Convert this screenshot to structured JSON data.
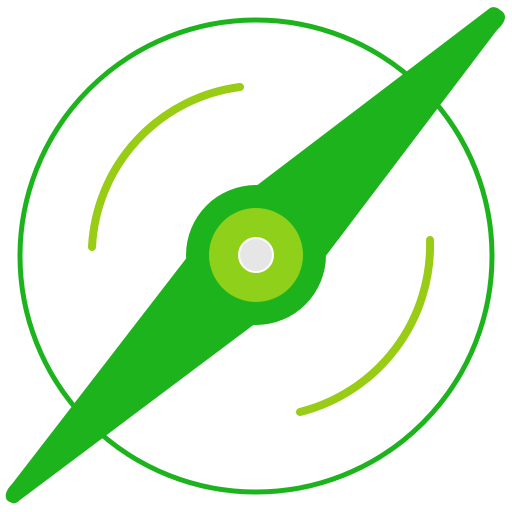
{
  "icon": {
    "name": "propeller-icon",
    "colors": {
      "ring": "#1db31d",
      "blade": "#1db31d",
      "hub_outer": "#1db31d",
      "hub_inner": "#8fd11a",
      "hub_center": "#e6e6e6",
      "motion_arcs": "#99cc14",
      "background": "#ffffff"
    }
  }
}
